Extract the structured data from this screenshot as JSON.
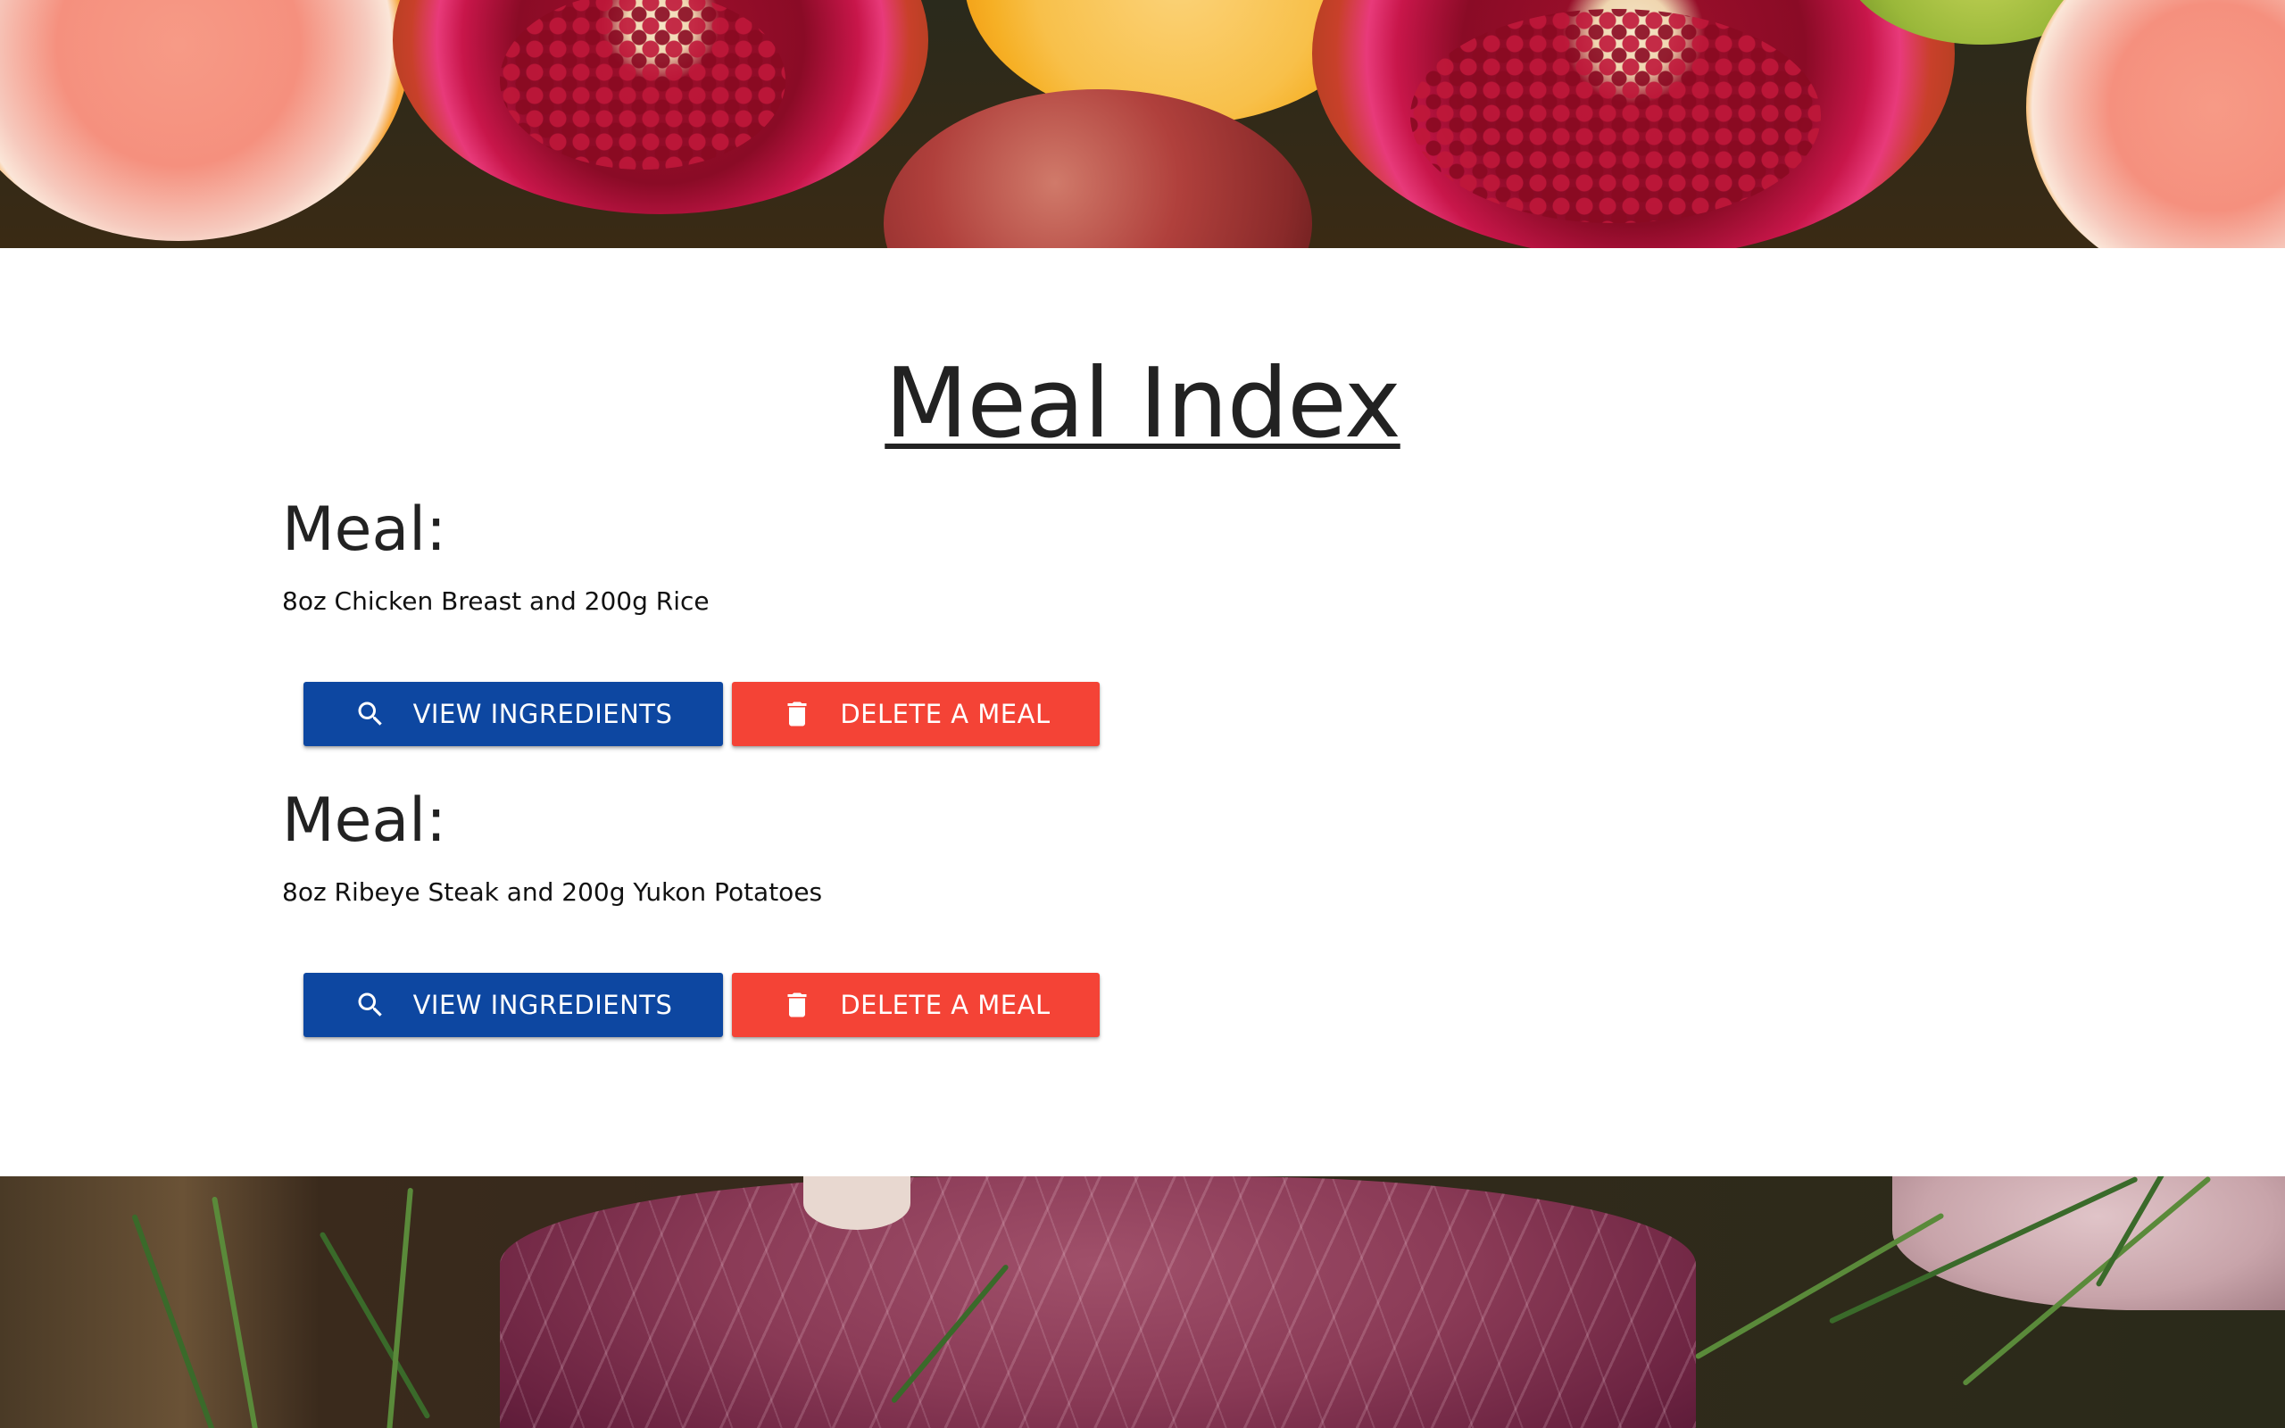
{
  "page": {
    "title": "Meal Index"
  },
  "meals": [
    {
      "heading": "Meal:",
      "description": "8oz Chicken Breast and 200g Rice",
      "view_label": "VIEW INGREDIENTS",
      "delete_label": "DELETE A MEAL"
    },
    {
      "heading": "Meal:",
      "description": "8oz Ribeye Steak and 200g Yukon Potatoes",
      "view_label": "VIEW INGREDIENTS",
      "delete_label": "DELETE A MEAL"
    }
  ],
  "icons": {
    "view": "search-icon",
    "delete": "trash-icon"
  },
  "colors": {
    "view_button": "#0d47a1",
    "delete_button": "#f44336",
    "text": "#222222"
  }
}
